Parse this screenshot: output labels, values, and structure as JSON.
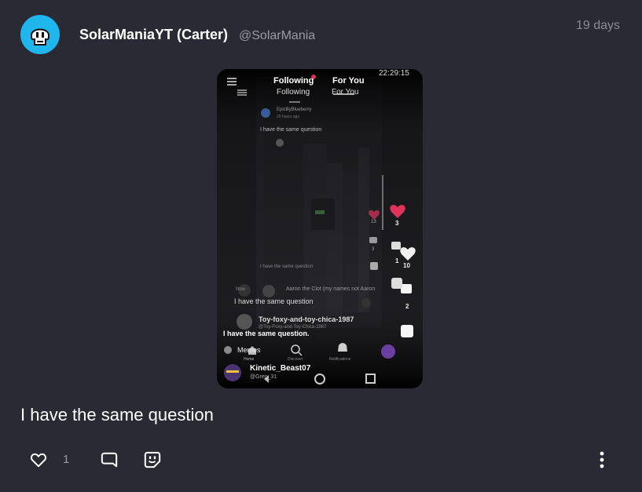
{
  "post": {
    "author_name": "SolarManiaYT (Carter)",
    "author_handle": "@SolarMania",
    "timestamp": "19 days",
    "text": "I have the same question",
    "like_count": "1"
  },
  "embedded_screenshot": {
    "status_time": "22:29:15",
    "tab_following": "Following",
    "tab_foryou": "For You",
    "inner_tab_following": "Following",
    "inner_tab_foryou": "For You",
    "inner_user": "EpicByBlueberry",
    "inner_time": "20 hours ago",
    "inner_text": "I have the same question",
    "deep_text": "I have the same question",
    "aaron_line": "Aaron the Clot (my names not Aaron",
    "deep_question": "I have the same question",
    "reply_user": "Toy-foxy-and-toy-chica-1987",
    "reply_handle": "@Toy-Foxy-and-Toy-Chica-1987",
    "reply_text": "I have the same question.",
    "memes_label": "Memes",
    "nav_home": "Home",
    "nav_discover": "Discover",
    "nav_notifications": "Notifications",
    "bottom_user": "Kinetic_Beast07",
    "bottom_handle": "@Gren_31",
    "inner_like_count": "13",
    "inner_comment_count": "3",
    "outer_like_count": "3",
    "outer_comment_count": "1",
    "right_like_count": "10",
    "right_comment_count": "2",
    "label_now": "Now"
  },
  "colors": {
    "background": "#292a34",
    "avatar": "#1fb6ee",
    "heart": "#e0335b"
  },
  "icons": [
    "avatar-ghost-icon",
    "heart-icon",
    "comment-icon",
    "sticker-icon",
    "more-vertical-icon"
  ]
}
